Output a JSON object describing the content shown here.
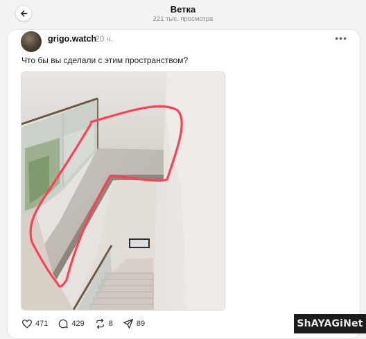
{
  "header": {
    "title": "Ветка",
    "subtitle": "221 тыс. просмотра"
  },
  "post": {
    "username": "grigo.watch",
    "time": "20 ч.",
    "text": "Что бы вы сделали с этим пространством?",
    "more_icon": "more-dots-icon",
    "image": "photo-staircase-with-red-marking"
  },
  "actions": {
    "likes": "471",
    "replies": "429",
    "reposts": "8",
    "shares": "89"
  },
  "watermark": {
    "text": "ShAYAGiNet"
  },
  "colors": {
    "accent_marker": "#ff3f56",
    "text": "#111111",
    "muted": "#999999"
  }
}
